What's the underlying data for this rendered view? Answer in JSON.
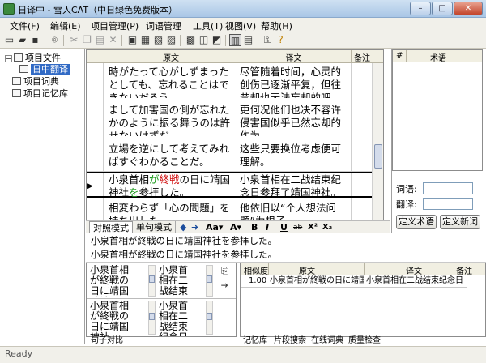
{
  "window": {
    "title": "日译中 - 雪人CAT（中日绿色免费版本）",
    "min_glyph": "–",
    "max_glyph": "□",
    "close_glyph": "✕"
  },
  "menu": [
    "文件(F)",
    "编辑(E)",
    "项目管理(P)",
    "词语管理",
    "工具(T)",
    "视图(V)",
    "帮助(H)"
  ],
  "tree": {
    "project_files": "项目文件",
    "zh_translation": "日中翻译",
    "project_glossary": "项目词典",
    "project_memory": "项目记忆库"
  },
  "grid": {
    "headers": {
      "source": "原文",
      "target": "译文",
      "note": "备注"
    },
    "rows": [
      {
        "source": "時がたって心がしずまったとしても、忘れることはできないだろう。",
        "target": "尽管随着时间，心灵的创伤已逐渐平复，但往昔却也无法忘却的吧。"
      },
      {
        "source": "まして加害国の側が忘れたかのように振る舞うのは許せないはずだ。",
        "target": "更何况他们也决不容许侵害国似乎已然忘却的作为。"
      },
      {
        "source": "立場を逆にして考えてみればすぐわかることだ。",
        "target": "这些只要换位考虑便可理解。"
      },
      {
        "source_a": "小泉首相",
        "source_b": "が",
        "source_c": "終戦",
        "source_d": "の日に靖国神社",
        "source_e": "を",
        "source_f": "参拝した。",
        "target": "小泉首相在二战结束纪念日参拜了靖国神社。"
      },
      {
        "source": "相変わらず「心の問題」を持ち出した",
        "target": "他依旧以“个人想法问题”为根子"
      }
    ]
  },
  "term_panel": {
    "col_no": "#",
    "col_term": "术语",
    "word_label": "词语:",
    "translation_label": "翻译:",
    "define_term_button": "定义术语",
    "define_new_button": "定义新词"
  },
  "edit": {
    "tab_compare": "对照模式",
    "tab_single": "单句模式",
    "aa_label": "Aa▾",
    "text_color_label": "A▾",
    "bold": "B",
    "italic": "I",
    "underline": "U",
    "strike": "ab",
    "superscript": "X²",
    "subscript": "X₂",
    "source_line": "小泉首相が終戦の日に靖国神社を参拝した。",
    "target_line": "小泉首相が終戦の日に靖国神社を参拝した。"
  },
  "bottom_left": {
    "col1_top": "小泉首相が終戦の日に靖国神社",
    "col1_bottom": "小泉首相が終戦の日に靖国神社",
    "col2_top": "小泉首相在二战结束",
    "col2_bottom": "小泉首相在二战结束纪念日"
  },
  "memory": {
    "headers": {
      "similarity": "相似度",
      "source": "原文",
      "target": "译文",
      "note": "备注"
    },
    "rows": [
      {
        "similarity": "1.00",
        "source": "小泉首相が終戦の日に靖国神",
        "target": "小泉首相在二战结束纪念日"
      }
    ]
  },
  "bottom_tabs": {
    "sentence_compare": "句子对比",
    "memory": "记忆库",
    "fragment_search": "片段搜索",
    "online_dict": "在线词典",
    "quality_check": "质量检查"
  },
  "status": "Ready"
}
